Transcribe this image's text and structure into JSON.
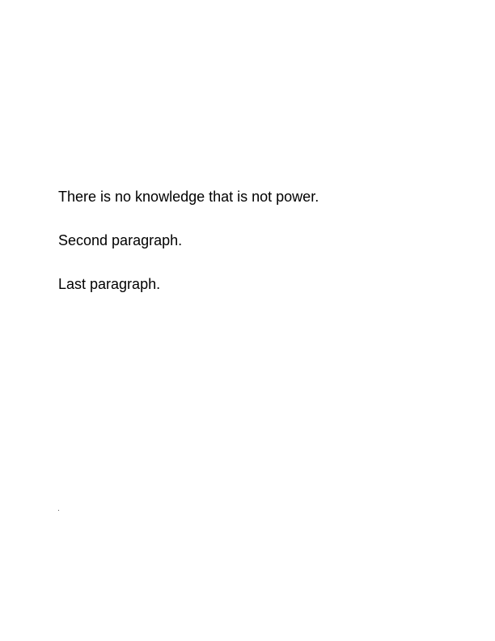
{
  "document": {
    "paragraphs": [
      "There is no knowledge that is not power.",
      "Second paragraph.",
      "Last paragraph."
    ]
  }
}
